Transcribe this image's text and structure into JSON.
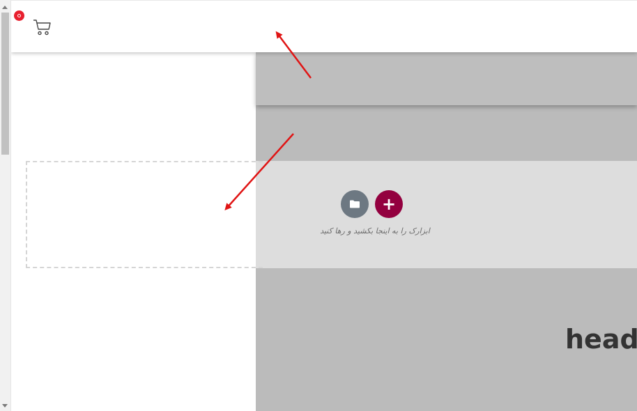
{
  "header": {
    "cart_badge_count": ""
  },
  "dropzone": {
    "hint": "ابزارک را به اینجا بکشید و رها کنید",
    "add_label": "+"
  },
  "section": {
    "heading": "heade"
  },
  "colors": {
    "badge": "#e8202f",
    "add_button": "#93003f",
    "folder_button": "#6d7882",
    "annotation_arrow": "#e01414"
  },
  "icons": [
    "cart-icon",
    "folder-icon",
    "plus-icon",
    "scroll-up-icon",
    "scroll-down-icon"
  ]
}
